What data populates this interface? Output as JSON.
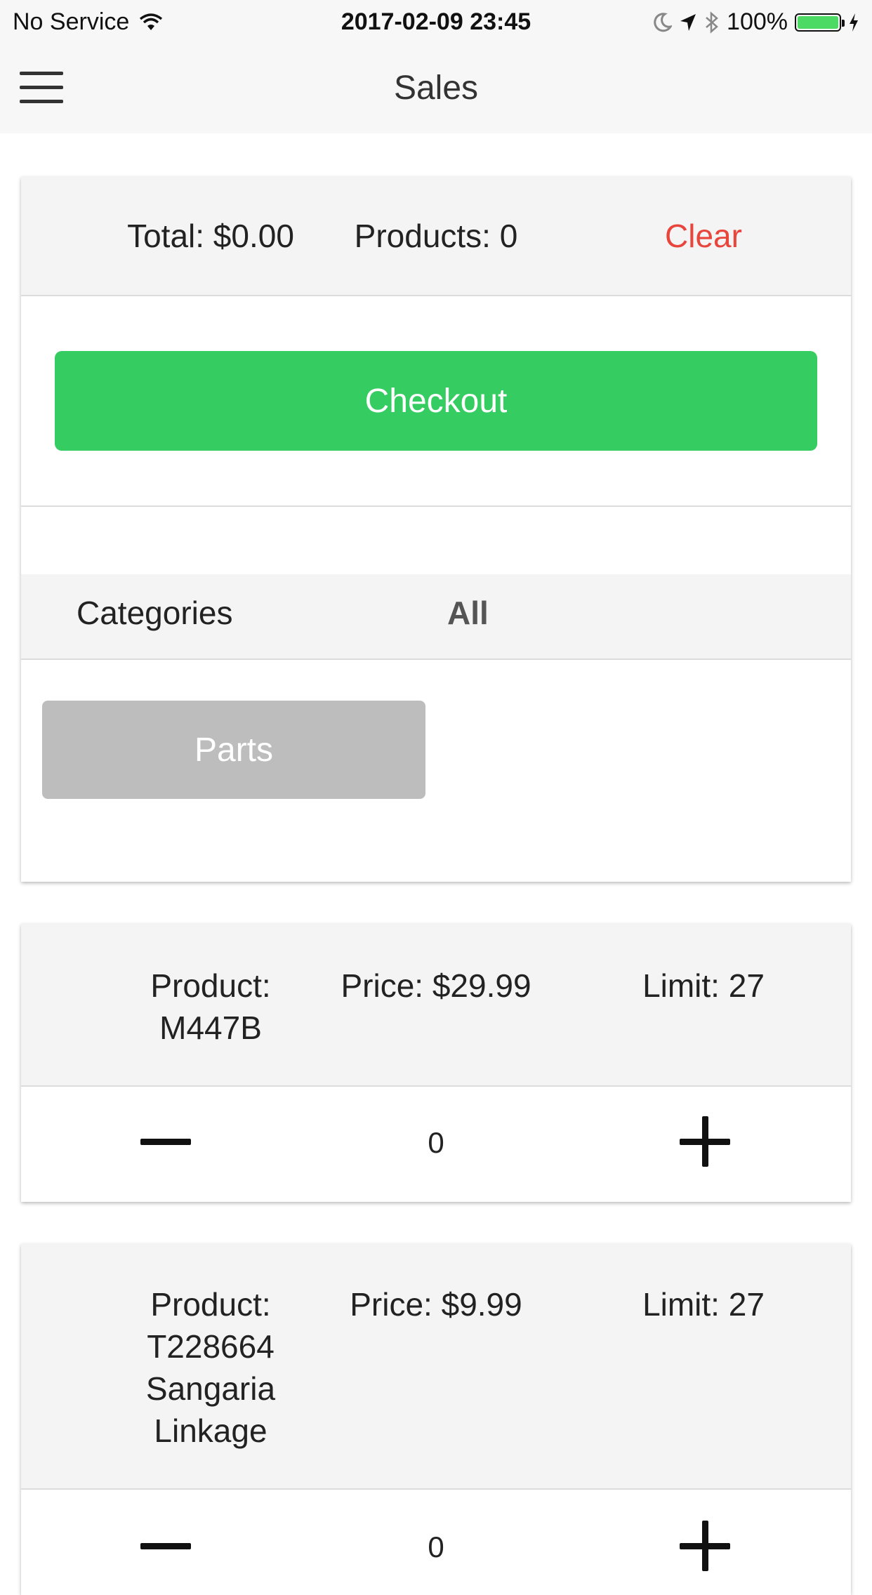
{
  "status_bar": {
    "carrier": "No Service",
    "time": "2017-02-09 23:45",
    "battery": "100%",
    "battery_level": 1.0
  },
  "nav": {
    "title": "Sales"
  },
  "summary": {
    "total": "Total: $0.00",
    "products": "Products: 0",
    "clear_label": "Clear",
    "checkout_label": "Checkout"
  },
  "categories": {
    "label": "Categories",
    "selected": "All",
    "items": [
      {
        "label": "Parts"
      }
    ]
  },
  "products": [
    {
      "name_lines": [
        "Product:",
        "M447B"
      ],
      "price": "Price: $29.99",
      "limit": "Limit: 27",
      "quantity": "0"
    },
    {
      "name_lines": [
        "Product:",
        "T228664",
        "Sangaria",
        "Linkage"
      ],
      "price": "Price: $9.99",
      "limit": "Limit: 27",
      "quantity": "0"
    }
  ],
  "colors": {
    "accent_green": "#35cc61",
    "clear_red": "#e8453c",
    "category_gray": "#bdbdbd"
  }
}
